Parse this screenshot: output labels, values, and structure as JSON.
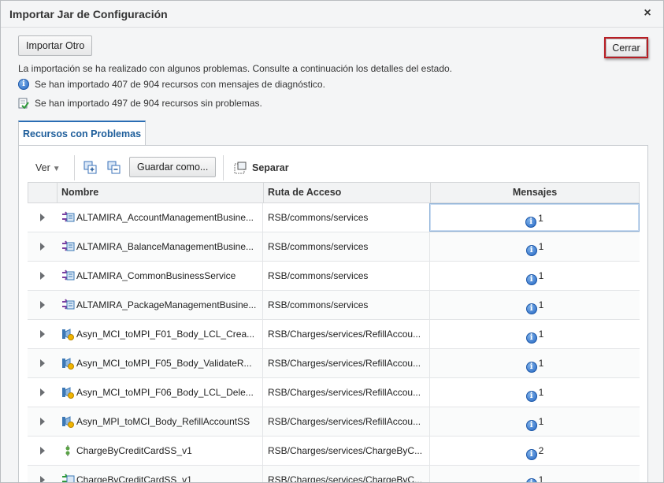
{
  "dialog": {
    "title": "Importar Jar de Configuración",
    "close_glyph": "×"
  },
  "buttons": {
    "import_other": "Importar Otro",
    "close": "Cerrar"
  },
  "status": {
    "summary": "La importación se ha realizado con algunos problemas. Consulte a continuación los detalles del estado.",
    "with_messages": "Se han importado 407 de 904 recursos con mensajes de diagnóstico.",
    "without_problems": "Se han importado 497 de 904 recursos sin problemas."
  },
  "tab": {
    "label": "Recursos con Problemas"
  },
  "toolbar": {
    "view_label": "Ver",
    "save_as_label": "Guardar como...",
    "detach_label": "Separar"
  },
  "table": {
    "columns": [
      "Nombre",
      "Ruta de Acceso",
      "Mensajes"
    ],
    "rows": [
      {
        "icon": "business-service-icon",
        "name": "ALTAMIRA_AccountManagementBusine...",
        "path": "RSB/commons/services",
        "messages": "1"
      },
      {
        "icon": "business-service-icon",
        "name": "ALTAMIRA_BalanceManagementBusine...",
        "path": "RSB/commons/services",
        "messages": "1"
      },
      {
        "icon": "business-service-icon",
        "name": "ALTAMIRA_CommonBusinessService",
        "path": "RSB/commons/services",
        "messages": "1"
      },
      {
        "icon": "business-service-icon",
        "name": "ALTAMIRA_PackageManagementBusine...",
        "path": "RSB/commons/services",
        "messages": "1"
      },
      {
        "icon": "pipeline-icon",
        "name": "Asyn_MCI_toMPI_F01_Body_LCL_Crea...",
        "path": "RSB/Charges/services/RefillAccou...",
        "messages": "1"
      },
      {
        "icon": "pipeline-icon",
        "name": "Asyn_MCI_toMPI_F05_Body_ValidateR...",
        "path": "RSB/Charges/services/RefillAccou...",
        "messages": "1"
      },
      {
        "icon": "pipeline-icon",
        "name": "Asyn_MCI_toMPI_F06_Body_LCL_Dele...",
        "path": "RSB/Charges/services/RefillAccou...",
        "messages": "1"
      },
      {
        "icon": "pipeline-icon",
        "name": "Asyn_MPI_toMCI_Body_RefillAccountSS",
        "path": "RSB/Charges/services/RefillAccou...",
        "messages": "1"
      },
      {
        "icon": "split-join-icon",
        "name": "ChargeByCreditCardSS_v1",
        "path": "RSB/Charges/services/ChargeByC...",
        "messages": "2"
      },
      {
        "icon": "proxy-service-icon",
        "name": "ChargeByCreditCardSS_v1",
        "path": "RSB/Charges/services/ChargeByC...",
        "messages": "1"
      }
    ]
  },
  "colors": {
    "accent": "#2a6db4",
    "close_highlight": "#b81e24",
    "info_blue": "#2668c4"
  }
}
